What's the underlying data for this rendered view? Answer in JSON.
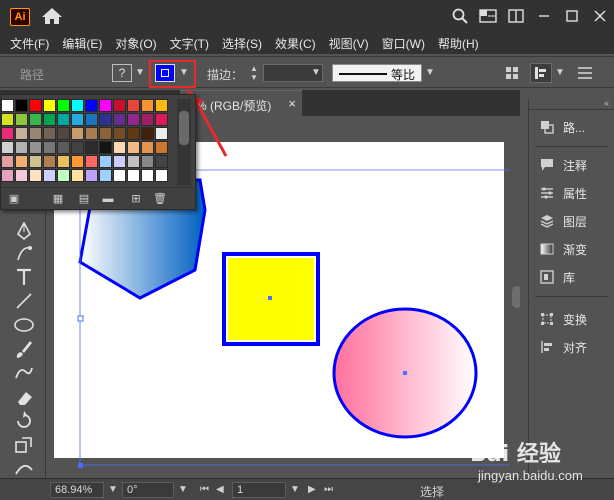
{
  "app": {
    "logo_text": "Ai"
  },
  "menu": {
    "items": [
      "文件(F)",
      "编辑(E)",
      "对象(O)",
      "文字(T)",
      "选择(S)",
      "效果(C)",
      "视图(V)",
      "窗口(W)",
      "帮助(H)"
    ]
  },
  "control_bar": {
    "object_label": "路径",
    "fill_symbol": "?",
    "stroke_label": "描边：",
    "stroke_color": "#0000ff",
    "profile_label": "等比"
  },
  "document_tab": {
    "label": "% (RGB/预览)",
    "close_symbol": "×"
  },
  "swatches": {
    "rows": [
      [
        "#ffffff",
        "#000000",
        "#ff0000",
        "#ffff00",
        "#00ff00",
        "#00ffff",
        "#0000ff",
        "#ff00ff",
        "#c8102e",
        "#e8463a",
        "#f79433",
        "#fdb913"
      ],
      [
        "#d6df23",
        "#8dc63f",
        "#39b54a",
        "#00a651",
        "#00a99d",
        "#27aae1",
        "#1c75bc",
        "#2e3192",
        "#662d91",
        "#92278f",
        "#9e1f63",
        "#da1c5c"
      ],
      [
        "#ee2a7b",
        "#c7b299",
        "#998675",
        "#736357",
        "#534741",
        "#c69c6d",
        "#a67c52",
        "#8c6239",
        "#754c24",
        "#603913",
        "#42210b",
        "#ededed"
      ],
      [
        "#d0d0d0",
        "#b2b2b2",
        "#939393",
        "#777777",
        "#5b5b5b",
        "#424242",
        "#2b2b2b",
        "#141414",
        "#f9d8b3",
        "#f3b985",
        "#e3954f",
        "#c9762f"
      ],
      [
        "#e0a0a0",
        "#f0b070",
        "#d0c090",
        "#b08050",
        "#e8c060",
        "#ff9933",
        "#ff6666",
        "#99ccff",
        "#ccccff",
        "#c0c0c0",
        "#888888",
        "#444444"
      ],
      [
        "#e8a0c0",
        "#f4c8d8",
        "#ffe0c0",
        "#d0d0ff",
        "#c0ffc0",
        "#ffe0a0",
        "#c0a0ff",
        "#a0d0ff",
        "#ffffff",
        "#ffffff",
        "#ffffff",
        "#ffffff"
      ]
    ]
  },
  "right_panel": {
    "items": [
      {
        "label": "路...",
        "icon": "path-panel-icon"
      },
      {
        "label": "注释",
        "icon": "comment-icon"
      },
      {
        "label": "属性",
        "icon": "properties-icon"
      },
      {
        "label": "图层",
        "icon": "layers-icon"
      },
      {
        "label": "渐变",
        "icon": "gradient-icon"
      },
      {
        "label": "库",
        "icon": "library-icon"
      },
      {
        "label": "变换",
        "icon": "transform-icon"
      },
      {
        "label": "对齐",
        "icon": "align-icon"
      }
    ]
  },
  "status_bar": {
    "zoom": "68.94%",
    "rotation": "0°",
    "artboard_number": "1",
    "mode_label": "选择"
  },
  "watermark": {
    "logo": "Bai 经验",
    "url": "jingyan.baidu.com"
  },
  "shapes": {
    "square_fill": "#ffff00",
    "stroke_color": "#0000ff",
    "circle_gradient": [
      "#ff6f9c",
      "#ffffff"
    ],
    "hexagon_gradient": [
      "#ffffff",
      "#0060c0"
    ]
  }
}
